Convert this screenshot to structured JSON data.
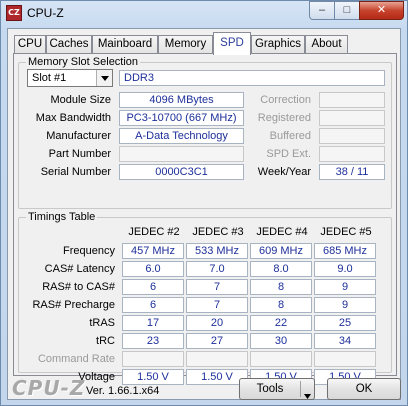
{
  "window": {
    "title": "CPU-Z",
    "icon_text": "CZ",
    "icon_name": "cpu-z-app-icon",
    "minimize_glyph": "–",
    "maximize_glyph": "□",
    "close_glyph": "✕"
  },
  "tabs": [
    {
      "label": "CPU"
    },
    {
      "label": "Caches"
    },
    {
      "label": "Mainboard"
    },
    {
      "label": "Memory"
    },
    {
      "label": "SPD",
      "active": true
    },
    {
      "label": "Graphics"
    },
    {
      "label": "About"
    }
  ],
  "memory_slot": {
    "group_title": "Memory Slot Selection",
    "slot_value": "Slot #1",
    "memory_type": "DDR3",
    "fields": {
      "module_size": {
        "label": "Module Size",
        "value": "4096 MBytes"
      },
      "max_bandwidth": {
        "label": "Max Bandwidth",
        "value": "PC3-10700 (667 MHz)"
      },
      "manufacturer": {
        "label": "Manufacturer",
        "value": "A-Data Technology"
      },
      "part_number": {
        "label": "Part Number",
        "value": ""
      },
      "serial_number": {
        "label": "Serial Number",
        "value": "0000C3C1"
      }
    },
    "right_fields": {
      "correction": {
        "label": "Correction",
        "value": ""
      },
      "registered": {
        "label": "Registered",
        "value": ""
      },
      "buffered": {
        "label": "Buffered",
        "value": ""
      },
      "spd_ext": {
        "label": "SPD Ext.",
        "value": ""
      },
      "week_year": {
        "label": "Week/Year",
        "value": "38 / 11"
      }
    }
  },
  "timings": {
    "group_title": "Timings Table",
    "columns": [
      "JEDEC #2",
      "JEDEC #3",
      "JEDEC #4",
      "JEDEC #5"
    ],
    "rows": [
      {
        "label": "Frequency",
        "values": [
          "457 MHz",
          "533 MHz",
          "609 MHz",
          "685 MHz"
        ]
      },
      {
        "label": "CAS# Latency",
        "values": [
          "6.0",
          "7.0",
          "8.0",
          "9.0"
        ]
      },
      {
        "label": "RAS# to CAS#",
        "values": [
          "6",
          "7",
          "8",
          "9"
        ]
      },
      {
        "label": "RAS# Precharge",
        "values": [
          "6",
          "7",
          "8",
          "9"
        ]
      },
      {
        "label": "tRAS",
        "values": [
          "17",
          "20",
          "22",
          "25"
        ]
      },
      {
        "label": "tRC",
        "values": [
          "23",
          "27",
          "30",
          "34"
        ]
      },
      {
        "label": "Command Rate",
        "values": [
          "",
          "",
          "",
          ""
        ],
        "disabled": true
      },
      {
        "label": "Voltage",
        "values": [
          "1.50 V",
          "1.50 V",
          "1.50 V",
          "1.50 V"
        ]
      }
    ]
  },
  "footer": {
    "logo": "CPU-Z",
    "version": "Ver. 1.66.1.x64",
    "tools_label": "Tools",
    "ok_label": "OK"
  },
  "colors": {
    "value_text": "#1d2f9a",
    "active_tab_text": "#2c3d9c",
    "close_button": "#c7432d"
  }
}
